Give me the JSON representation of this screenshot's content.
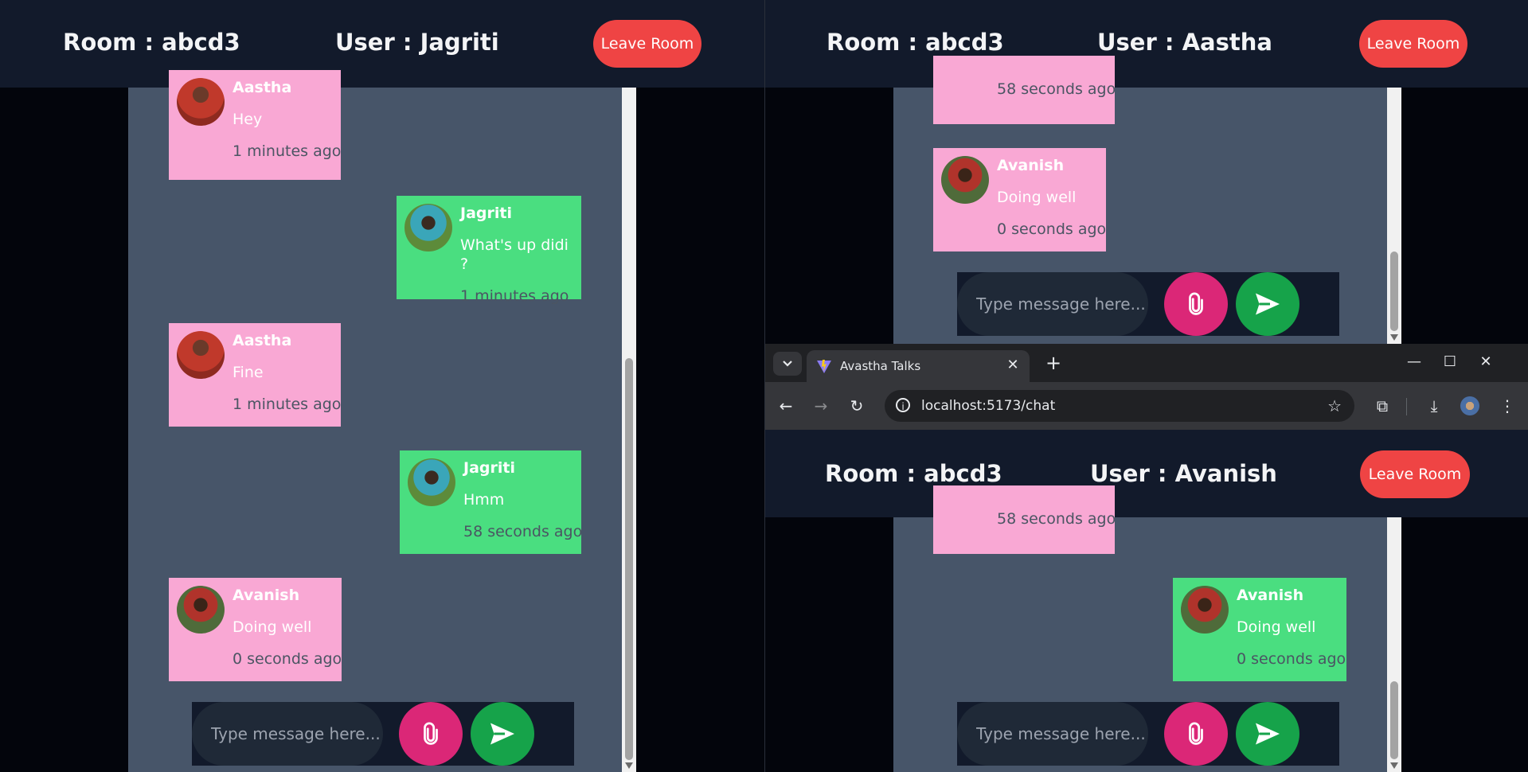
{
  "panes": [
    {
      "room": "Room : abcd3",
      "user": "User : Jagriti",
      "leave_label": "Leave Room",
      "placeholder": "Type message here...",
      "messages": [
        {
          "sender": "Aastha",
          "text": "Hey",
          "time": "1 minutes ago",
          "side": "left"
        },
        {
          "sender": "Jagriti",
          "text": "What's up didi ?",
          "time": "1 minutes ago",
          "side": "right"
        },
        {
          "sender": "Aastha",
          "text": "Fine",
          "time": "1 minutes ago",
          "side": "left"
        },
        {
          "sender": "Jagriti",
          "text": "Hmm",
          "time": "58 seconds ago",
          "side": "right"
        },
        {
          "sender": "Avanish",
          "text": "Doing well",
          "time": "0 seconds ago",
          "side": "left"
        }
      ]
    },
    {
      "room": "Room : abcd3",
      "user": "User : Aastha",
      "leave_label": "Leave Room",
      "placeholder": "Type message here...",
      "messages": [
        {
          "sender": "",
          "text": "",
          "time": "58 seconds ago",
          "side": "left"
        },
        {
          "sender": "Avanish",
          "text": "Doing well",
          "time": "0 seconds ago",
          "side": "left"
        }
      ]
    },
    {
      "room": "Room : abcd3",
      "user": "User : Avanish",
      "leave_label": "Leave Room",
      "placeholder": "Type message here...",
      "messages": [
        {
          "sender": "",
          "text": "",
          "time": "58 seconds ago",
          "side": "left"
        },
        {
          "sender": "Avanish",
          "text": "Doing well",
          "time": "0 seconds ago",
          "side": "right"
        }
      ]
    }
  ],
  "browser": {
    "tab_title": "Avastha Talks",
    "url": "localhost:5173/chat"
  },
  "colors": {
    "header_bg": "#121a2b",
    "chat_bg": "#475569",
    "incoming": "#f9a8d4",
    "outgoing": "#4ade80",
    "leave": "#ef4444",
    "attach": "#db2777",
    "send": "#16a34a"
  }
}
